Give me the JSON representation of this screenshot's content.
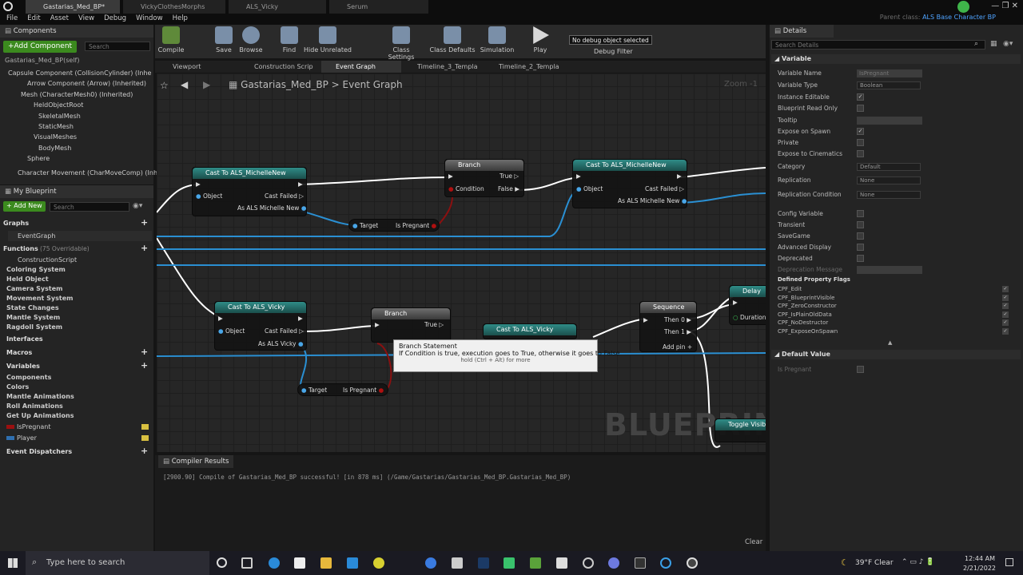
{
  "window": {
    "tabs": [
      "Gastarias_Med_BP*",
      "VickyClothesMorphs",
      "ALS_Vicky",
      "Serum"
    ],
    "parent_class_label": "Parent class:",
    "parent_class_value": "ALS Base Character BP"
  },
  "menu": [
    "File",
    "Edit",
    "Asset",
    "View",
    "Debug",
    "Window",
    "Help"
  ],
  "components": {
    "title": "Components",
    "add_label": "+Add Component",
    "search_placeholder": "Search",
    "self_label": "Gastarias_Med_BP(self)",
    "tree": [
      "Capsule Component (CollisionCylinder) (Inhe",
      "Arrow Component (Arrow) (Inherited)",
      "Mesh (CharacterMesh0) (Inherited)",
      "HeldObjectRoot",
      "SkeletalMesh",
      "StaticMesh",
      "VisualMeshes",
      "BodyMesh",
      "Sphere",
      "Character Movement (CharMoveComp) (Inhe"
    ]
  },
  "my_blueprint": {
    "title": "My Blueprint",
    "add_label": "+ Add New",
    "search_placeholder": "Search",
    "graphs_label": "Graphs",
    "event_graph": "EventGraph",
    "functions_label": "Functions",
    "functions_count": "(75 Overridable)",
    "functions": [
      "ConstructionScript",
      "Coloring System",
      "Held Object",
      "Camera System",
      "Movement System",
      "State Changes",
      "Mantle System",
      "Ragdoll System"
    ],
    "interfaces": "Interfaces",
    "macros": "Macros",
    "variables_label": "Variables",
    "variables": [
      "Components",
      "Colors",
      "Mantle Animations",
      "Roll Animations",
      "Get Up Animations"
    ],
    "vars": [
      "IsPregnant",
      "Player"
    ],
    "event_dispatchers": "Event Dispatchers"
  },
  "toolbar": {
    "buttons": [
      "Compile",
      "Save",
      "Browse",
      "Find",
      "Hide Unrelated",
      "Class Settings",
      "Class Defaults",
      "Simulation",
      "Play"
    ],
    "debug_object": "No debug object selected",
    "debug_filter": "Debug Filter"
  },
  "doc_tabs": [
    "Viewport",
    "Construction Scrip",
    "Event Graph",
    "Timeline_3_Templa",
    "Timeline_2_Templa"
  ],
  "graph": {
    "breadcrumb_root": "Gastarias_Med_BP",
    "breadcrumb_sep": ">",
    "breadcrumb_leaf": "Event Graph",
    "zoom": "Zoom -1",
    "watermark": "BLUEPRINT",
    "nodes": {
      "cast1": {
        "title": "Cast To ALS_MichelleNew",
        "object": "Object",
        "cast_failed": "Cast Failed",
        "out": "As ALS Michelle New"
      },
      "branch1": {
        "title": "Branch",
        "true": "True",
        "false": "False",
        "condition": "Condition"
      },
      "cast2": {
        "title": "Cast To ALS_MichelleNew",
        "object": "Object",
        "cast_failed": "Cast Failed",
        "out": "As ALS Michelle New"
      },
      "get1": {
        "target": "Target",
        "value": "Is Pregnant"
      },
      "cast3": {
        "title": "Cast To ALS_Vicky",
        "object": "Object",
        "cast_failed": "Cast Failed",
        "out": "As ALS Vicky"
      },
      "branch2": {
        "title": "Branch",
        "true": "True"
      },
      "cast4": {
        "title": "Cast To ALS_Vicky"
      },
      "sequence": {
        "title": "Sequence",
        "then0": "Then 0",
        "then1": "Then 1",
        "add_pin": "Add pin"
      },
      "delay": {
        "title": "Delay",
        "duration": "Duration"
      },
      "get2": {
        "target": "Target",
        "value": "Is Pregnant"
      },
      "toggle": {
        "title": "Toggle Visibi"
      }
    },
    "tooltip": {
      "title": "Branch Statement",
      "body": "If Condition is true, execution goes to True, otherwise it goes to False",
      "hint": "hold (Ctrl + Alt) for more"
    }
  },
  "compiler": {
    "tab": "Compiler Results",
    "message": "[2900.90] Compile of Gastarias_Med_BP successful! [in 878 ms] (/Game/Gastarias/Gastarias_Med_BP.Gastarias_Med_BP)",
    "clear": "Clear"
  },
  "details": {
    "title": "Details",
    "search_placeholder": "Search Details",
    "section": "Variable",
    "rows": [
      {
        "label": "Variable Name",
        "value": "IsPregnant",
        "kind": "text"
      },
      {
        "label": "Variable Type",
        "value": "Boolean",
        "kind": "combo"
      },
      {
        "label": "Instance Editable",
        "value": "✓",
        "kind": "check"
      },
      {
        "label": "Blueprint Read Only",
        "value": "",
        "kind": "check"
      },
      {
        "label": "Tooltip",
        "value": "",
        "kind": "text"
      },
      {
        "label": "Expose on Spawn",
        "value": "✓",
        "kind": "check"
      },
      {
        "label": "Private",
        "value": "",
        "kind": "check"
      },
      {
        "label": "Expose to Cinematics",
        "value": "",
        "kind": "check"
      },
      {
        "label": "Category",
        "value": "Default",
        "kind": "combo"
      },
      {
        "label": "Replication",
        "value": "None",
        "kind": "combo"
      },
      {
        "label": "Replication Condition",
        "value": "None",
        "kind": "combo"
      }
    ],
    "rows2": [
      {
        "label": "Config Variable"
      },
      {
        "label": "Transient"
      },
      {
        "label": "SaveGame"
      },
      {
        "label": "Advanced Display"
      },
      {
        "label": "Deprecated"
      },
      {
        "label": "Deprecation Message"
      }
    ],
    "flags_title": "Defined Property Flags",
    "flags": [
      "CPF_Edit",
      "CPF_BlueprintVisible",
      "CPF_ZeroConstructor",
      "CPF_IsPlainOldData",
      "CPF_NoDestructor",
      "CPF_ExposeOnSpawn"
    ],
    "default_section": "Default Value",
    "default_label": "Is Pregnant"
  },
  "taskbar": {
    "search_placeholder": "Type here to search",
    "weather": "39°F Clear",
    "time": "12:44 AM",
    "date": "2/21/2022"
  },
  "colors": {
    "exec": "#ffffff",
    "object_pin": "#49a6e8",
    "bool_pin": "#9b1010",
    "cast_header": "#2f8c87",
    "accent_green": "#3b8a1e",
    "link_blue": "#4fa3ff"
  }
}
